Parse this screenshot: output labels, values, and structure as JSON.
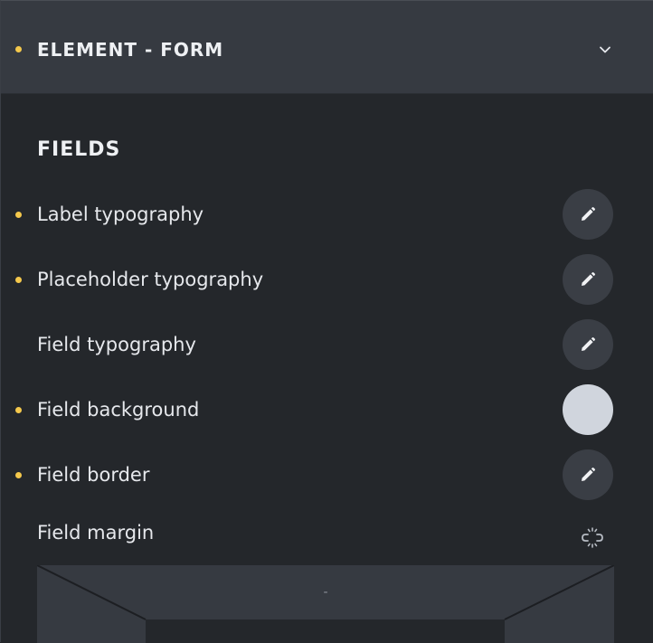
{
  "panel": {
    "title": "ELEMENT - FORM",
    "colors": {
      "modified_dot": "#f4c84c",
      "header_bg": "#363a41",
      "panel_bg": "#24272b"
    }
  },
  "fields_section": {
    "title": "FIELDS",
    "rows": [
      {
        "label": "Label typography",
        "modified": true,
        "control": "edit-button"
      },
      {
        "label": "Placeholder typography",
        "modified": true,
        "control": "edit-button"
      },
      {
        "label": "Field typography",
        "modified": false,
        "control": "edit-button"
      },
      {
        "label": "Field background",
        "modified": true,
        "control": "color-swatch",
        "color": "#d0d5dd"
      },
      {
        "label": "Field border",
        "modified": true,
        "control": "edit-button"
      }
    ],
    "margin": {
      "label": "Field margin",
      "top_value": "-",
      "link_icon": "unlink-icon"
    }
  }
}
